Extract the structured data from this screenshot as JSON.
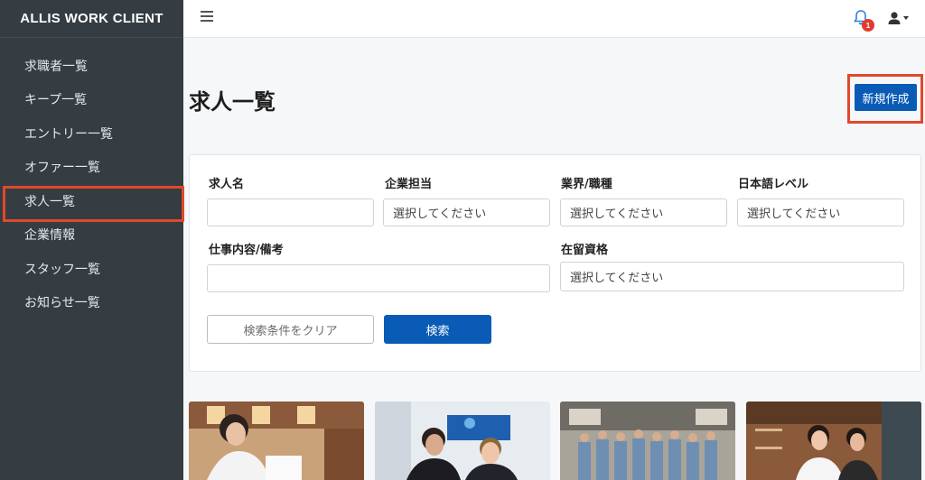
{
  "app": {
    "brand": "ALLIS WORK CLIENT"
  },
  "sidebar": {
    "items": [
      {
        "label": "求職者一覧"
      },
      {
        "label": "キープ一覧"
      },
      {
        "label": "エントリー一覧"
      },
      {
        "label": "オファー一覧"
      },
      {
        "label": "求人一覧"
      },
      {
        "label": "企業情報"
      },
      {
        "label": "スタッフ一覧"
      },
      {
        "label": "お知らせ一覧"
      }
    ],
    "active_index": 4
  },
  "topbar": {
    "notification_count": "1",
    "icons": [
      "menu-icon",
      "bell-icon",
      "user-icon",
      "caret-down-icon"
    ]
  },
  "page": {
    "title": "求人一覧",
    "new_button": "新規作成"
  },
  "search": {
    "job_name": {
      "label": "求人名",
      "value": ""
    },
    "company_rep": {
      "label": "企業担当",
      "placeholder": "選択してください"
    },
    "industry": {
      "label": "業界/職種",
      "placeholder": "選択してください"
    },
    "japanese_level": {
      "label": "日本語レベル",
      "placeholder": "選択してください"
    },
    "job_content": {
      "label": "仕事内容/備考",
      "value": ""
    },
    "visa_status": {
      "label": "在留資格",
      "placeholder": "選択してください"
    },
    "clear_button": "検索条件をクリア",
    "search_button": "検索"
  },
  "colors": {
    "sidebar_bg": "#353c42",
    "primary": "#0a5bb5",
    "highlight": "#e0492b",
    "badge": "#e23a2e"
  }
}
